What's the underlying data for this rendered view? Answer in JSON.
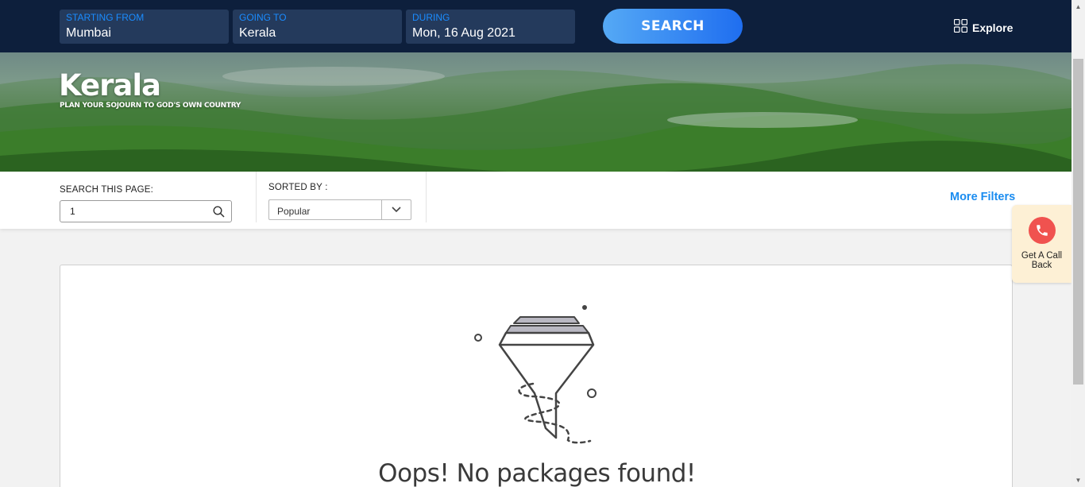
{
  "topbar": {
    "from": {
      "label": "STARTING FROM",
      "value": "Mumbai"
    },
    "to": {
      "label": "GOING TO",
      "value": "Kerala"
    },
    "during": {
      "label": "DURING",
      "value": "Mon, 16 Aug 2021"
    },
    "search_label": "SEARCH",
    "explore_label": "Explore",
    "explore_icon": "grid-icon"
  },
  "hero": {
    "title": "Kerala",
    "subtitle": "PLAN YOUR SOJOURN TO GOD'S OWN COUNTRY"
  },
  "filters": {
    "search_label": "SEARCH THIS PAGE:",
    "search_value": "1",
    "sort_label": "SORTED BY :",
    "sort_value": "Popular",
    "more_filters": "More Filters"
  },
  "results": {
    "empty_message": "Oops! No packages found!",
    "empty_icon": "funnel-icon"
  },
  "callback": {
    "label": "Get A Call Back",
    "icon": "phone-icon"
  },
  "colors": {
    "navy": "#0d1f3c",
    "field": "#243a5c",
    "accent": "#1a8cf0",
    "callback_bg": "#fdf0d5",
    "phone_red": "#f0524f"
  }
}
